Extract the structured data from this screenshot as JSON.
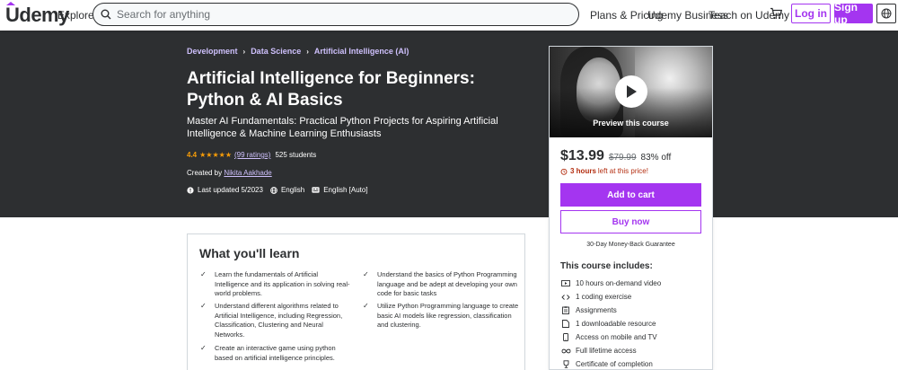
{
  "header": {
    "logo": "Udemy",
    "explore": "Explore",
    "search_placeholder": "Search for anything",
    "plans_pricing": "Plans & Pricing",
    "udemy_business": "Udemy Business",
    "teach": "Teach on Udemy",
    "login": "Log in",
    "signup": "Sign up"
  },
  "breadcrumb": [
    "Development",
    "Data Science",
    "Artificial Intelligence (AI)"
  ],
  "course": {
    "title": "Artificial Intelligence for Beginners: Python & AI Basics",
    "subtitle": "Master AI Fundamentals: Practical Python Projects for Aspiring Artificial Intelligence & Machine Learning Enthusiasts",
    "rating": "4.4",
    "stars": "★★★★★",
    "ratings_count": "(99 ratings)",
    "students": "525 students",
    "created_by_label": "Created by",
    "instructor": "Nikita Aakhade",
    "last_updated": "Last updated 5/2023",
    "language": "English",
    "captions": "English [Auto]"
  },
  "sidebar": {
    "preview_label": "Preview this course",
    "price": "$13.99",
    "original_price": "$79.99",
    "discount": "83% off",
    "time_left_bold": "3 hours",
    "time_left_text": "left at this price!",
    "add_to_cart": "Add to cart",
    "buy_now": "Buy now",
    "guarantee": "30-Day Money-Back Guarantee",
    "includes_title": "This course includes:",
    "includes": [
      {
        "icon": "video-icon",
        "text": "10 hours on-demand video"
      },
      {
        "icon": "code-icon",
        "text": "1 coding exercise"
      },
      {
        "icon": "assignment-icon",
        "text": "Assignments"
      },
      {
        "icon": "file-icon",
        "text": "1 downloadable resource"
      },
      {
        "icon": "mobile-icon",
        "text": "Access on mobile and TV"
      },
      {
        "icon": "infinity-icon",
        "text": "Full lifetime access"
      },
      {
        "icon": "trophy-icon",
        "text": "Certificate of completion"
      }
    ]
  },
  "learn": {
    "title": "What you'll learn",
    "items": [
      "Learn the fundamentals of Artificial Intelligence and its application in solving real-world problems.",
      "Understand the basics of Python Programming language and be adept at developing your own code for basic tasks",
      "Understand different algorithms related to Artificial Intelligence, including Regression, Classification, Clustering and Neural Networks.",
      "Utilize Python Programming language to create basic AI models like regression, classification and clustering.",
      "Create an interactive game using python based on artificial intelligence principles."
    ]
  },
  "colors": {
    "brand_purple": "#a435f0",
    "hero_bg": "#2d2f31",
    "link_lavender": "#cec0fc",
    "star_orange": "#f69c08",
    "alert_red": "#b32d0f"
  }
}
